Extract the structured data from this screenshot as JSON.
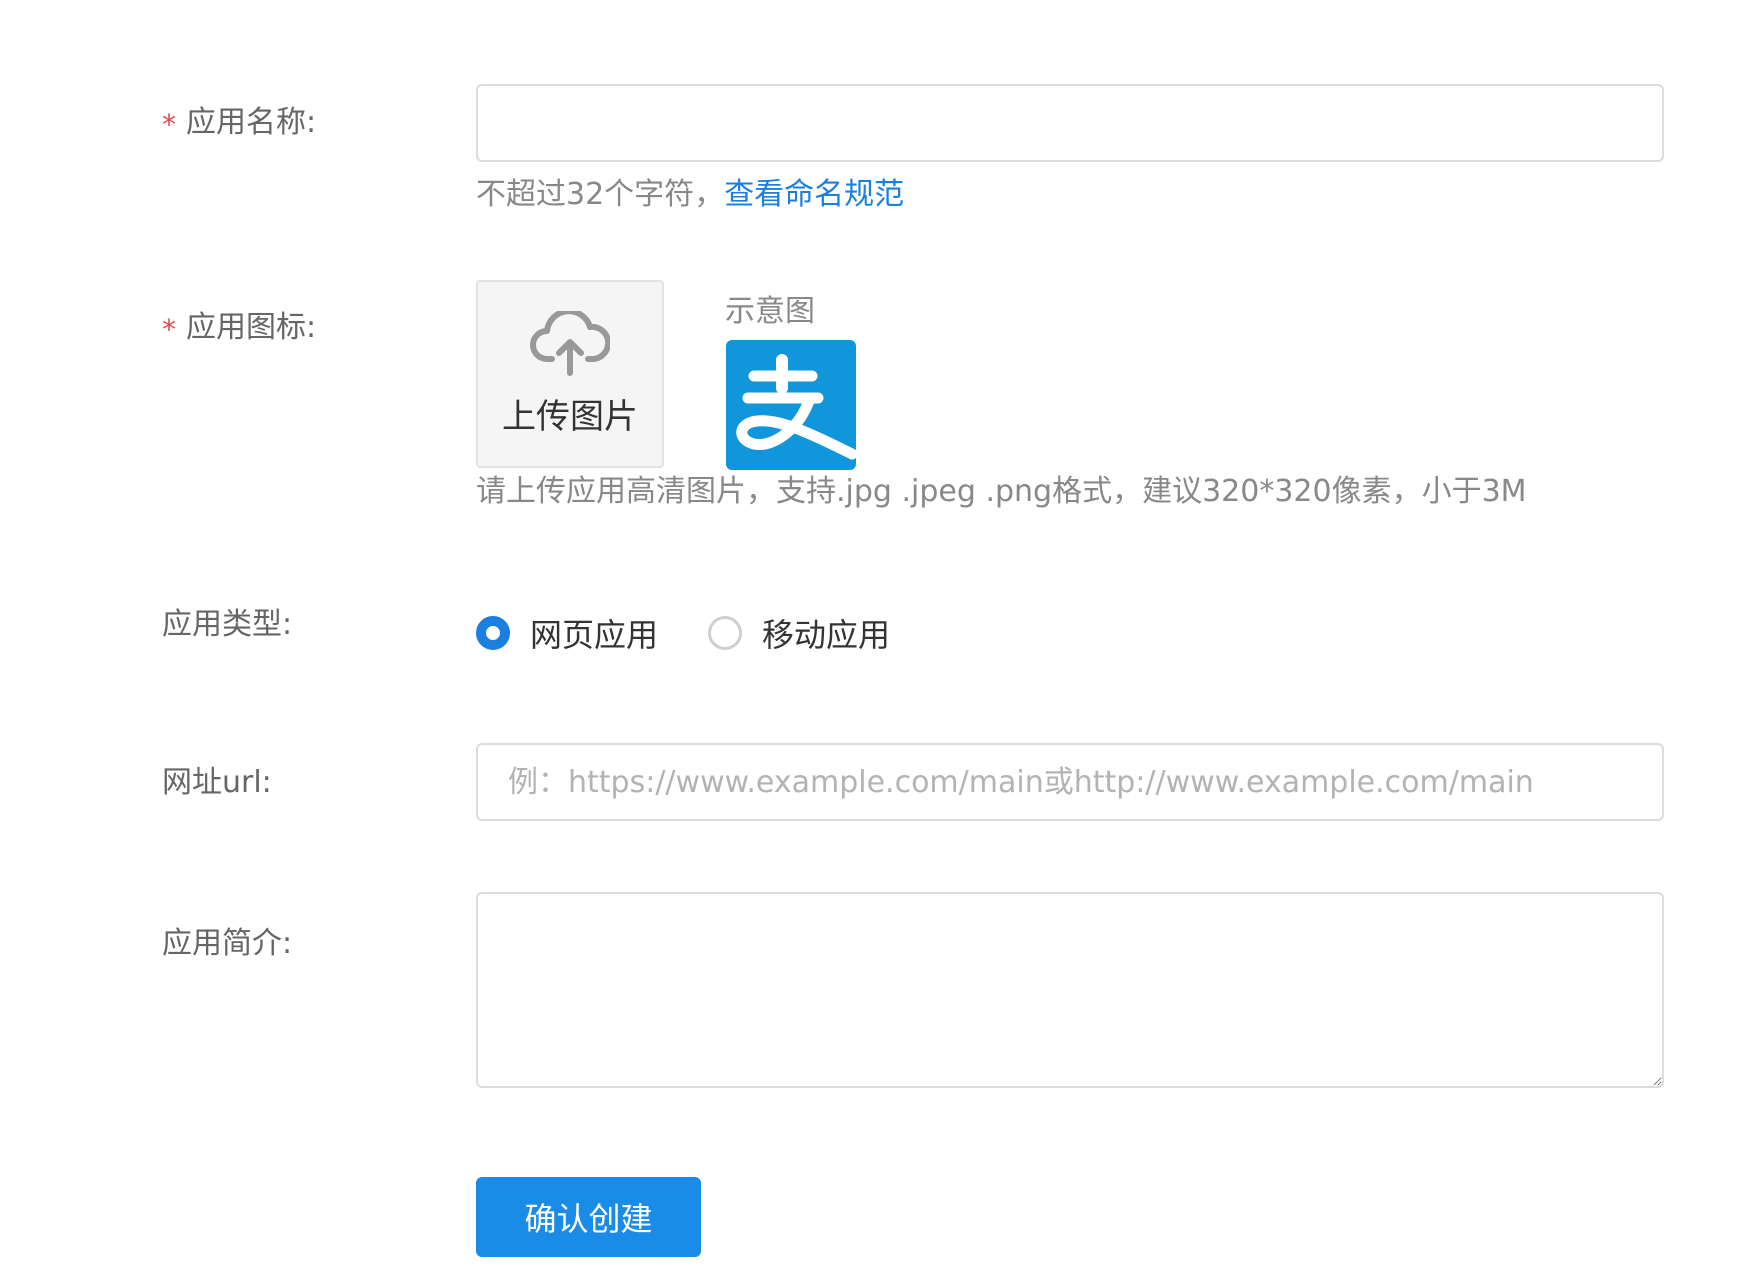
{
  "form": {
    "app_name": {
      "label": "应用名称:",
      "required_mark": "*",
      "value": "",
      "help_text": "不超过32个字符，",
      "help_link": "查看命名规范"
    },
    "app_icon": {
      "label": "应用图标:",
      "required_mark": "*",
      "upload_label": "上传图片",
      "upload_icon": "cloud-upload-icon",
      "sample_title": "示意图",
      "sample_icon": "alipay-logo",
      "help_text": "请上传应用高清图片，支持.jpg .jpeg .png格式，建议320*320像素，小于3M"
    },
    "app_type": {
      "label": "应用类型:",
      "options": [
        {
          "label": "网页应用",
          "checked": true
        },
        {
          "label": "移动应用",
          "checked": false
        }
      ]
    },
    "url": {
      "label": "网址url:",
      "value": "",
      "placeholder": "例：https://www.example.com/main或http://www.example.com/main"
    },
    "description": {
      "label": "应用简介:",
      "value": ""
    },
    "submit_label": "确认创建"
  },
  "colors": {
    "primary": "#1a8ce8",
    "link": "#1a7fe0",
    "required": "#e5484d",
    "sample_bg": "#1296db"
  }
}
